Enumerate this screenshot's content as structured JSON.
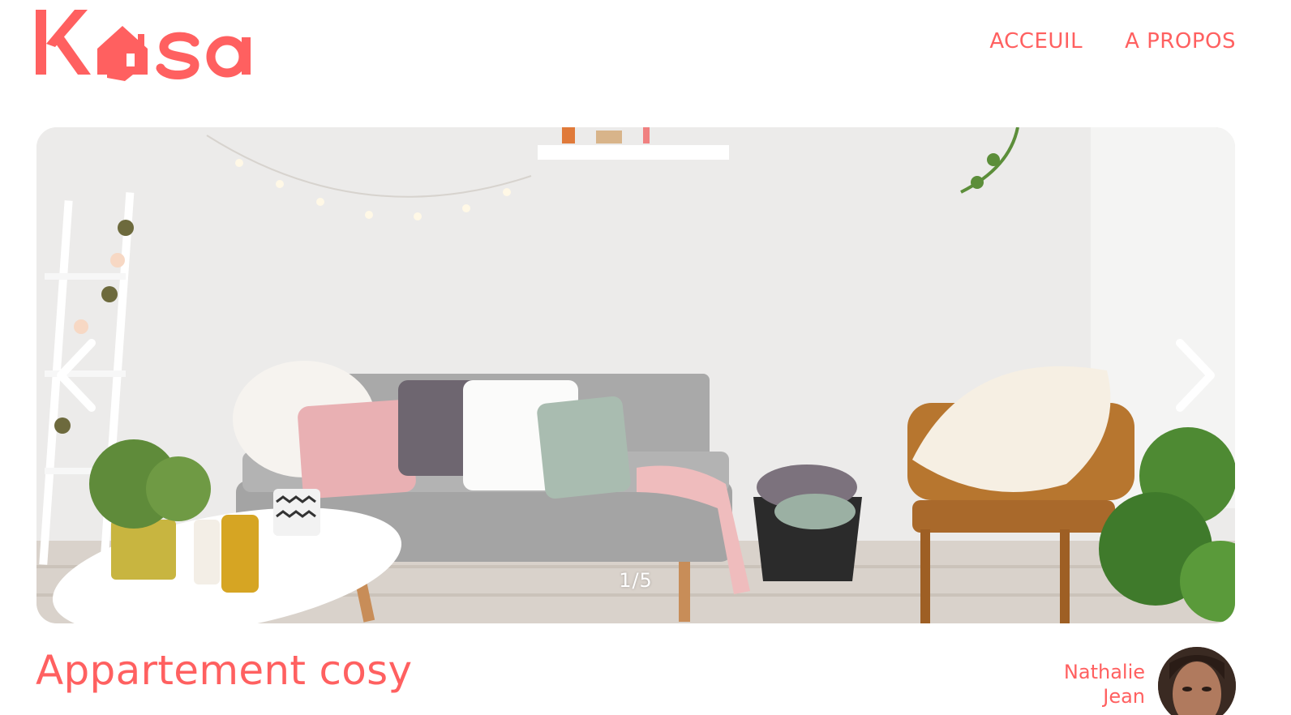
{
  "header": {
    "logo_text": "Kasa",
    "nav": {
      "home_label": "ACCEUIL",
      "about_label": "A PROPOS"
    }
  },
  "carousel": {
    "counter": "1/5",
    "current": 1,
    "total": 5
  },
  "listing": {
    "title": "Appartement cosy",
    "host": {
      "first_name": "Nathalie",
      "last_name": "Jean"
    }
  },
  "colors": {
    "brand": "#FF6060",
    "arrow": "#ffffff"
  },
  "icons": {
    "prev": "chevron-left-icon",
    "next": "chevron-right-icon"
  }
}
